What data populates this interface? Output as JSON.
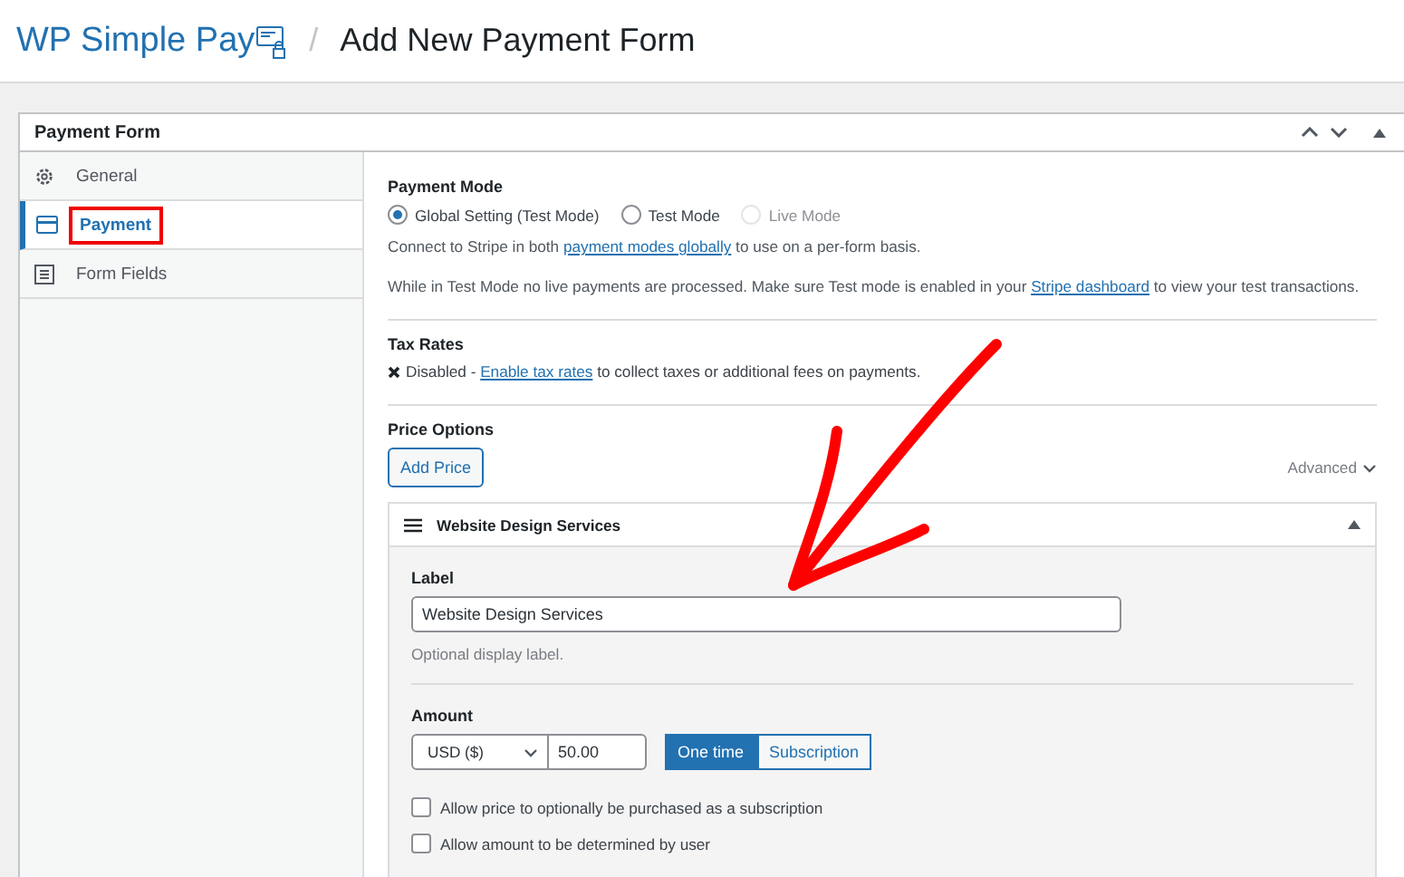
{
  "header": {
    "logo": "WP Simple Pay",
    "separator": "/",
    "title": "Add New Payment Form"
  },
  "panel": {
    "title": "Payment Form"
  },
  "tabs": [
    {
      "label": "General",
      "selected": false,
      "highlighted": false
    },
    {
      "label": "Payment",
      "selected": true,
      "highlighted": true
    },
    {
      "label": "Form Fields",
      "selected": false,
      "highlighted": false
    }
  ],
  "payment_mode": {
    "title": "Payment Mode",
    "options": [
      {
        "label": "Global Setting (Test Mode)",
        "selected": true,
        "disabled": false
      },
      {
        "label": "Test Mode",
        "selected": false,
        "disabled": false
      },
      {
        "label": "Live Mode",
        "selected": false,
        "disabled": true
      }
    ],
    "connect_note": {
      "before": "Connect to Stripe in both ",
      "link": "payment modes globally",
      "after": " to use on a per-form basis."
    },
    "test_note": {
      "before": "While in Test Mode no live payments are processed. Make sure Test mode is enabled in your ",
      "link": "Stripe dashboard",
      "after": " to view your test transactions."
    }
  },
  "tax_rates": {
    "title": "Tax Rates",
    "status": "Disabled - ",
    "link": "Enable tax rates",
    "rest": " to collect taxes or additional fees on payments."
  },
  "price_options": {
    "title": "Price Options",
    "add_button": "Add Price",
    "advanced": "Advanced",
    "price": {
      "name": "Website Design Services",
      "label_title": "Label",
      "label_value": "Website Design Services",
      "label_help": "Optional display label.",
      "amount_title": "Amount",
      "currency": "USD ($)",
      "amount": "50.00",
      "types": [
        {
          "label": "One time",
          "selected": true
        },
        {
          "label": "Subscription",
          "selected": false
        }
      ],
      "options": [
        {
          "label": "Allow price to optionally be purchased as a subscription",
          "checked": false
        },
        {
          "label": "Allow amount to be determined by user",
          "checked": false
        }
      ]
    }
  }
}
